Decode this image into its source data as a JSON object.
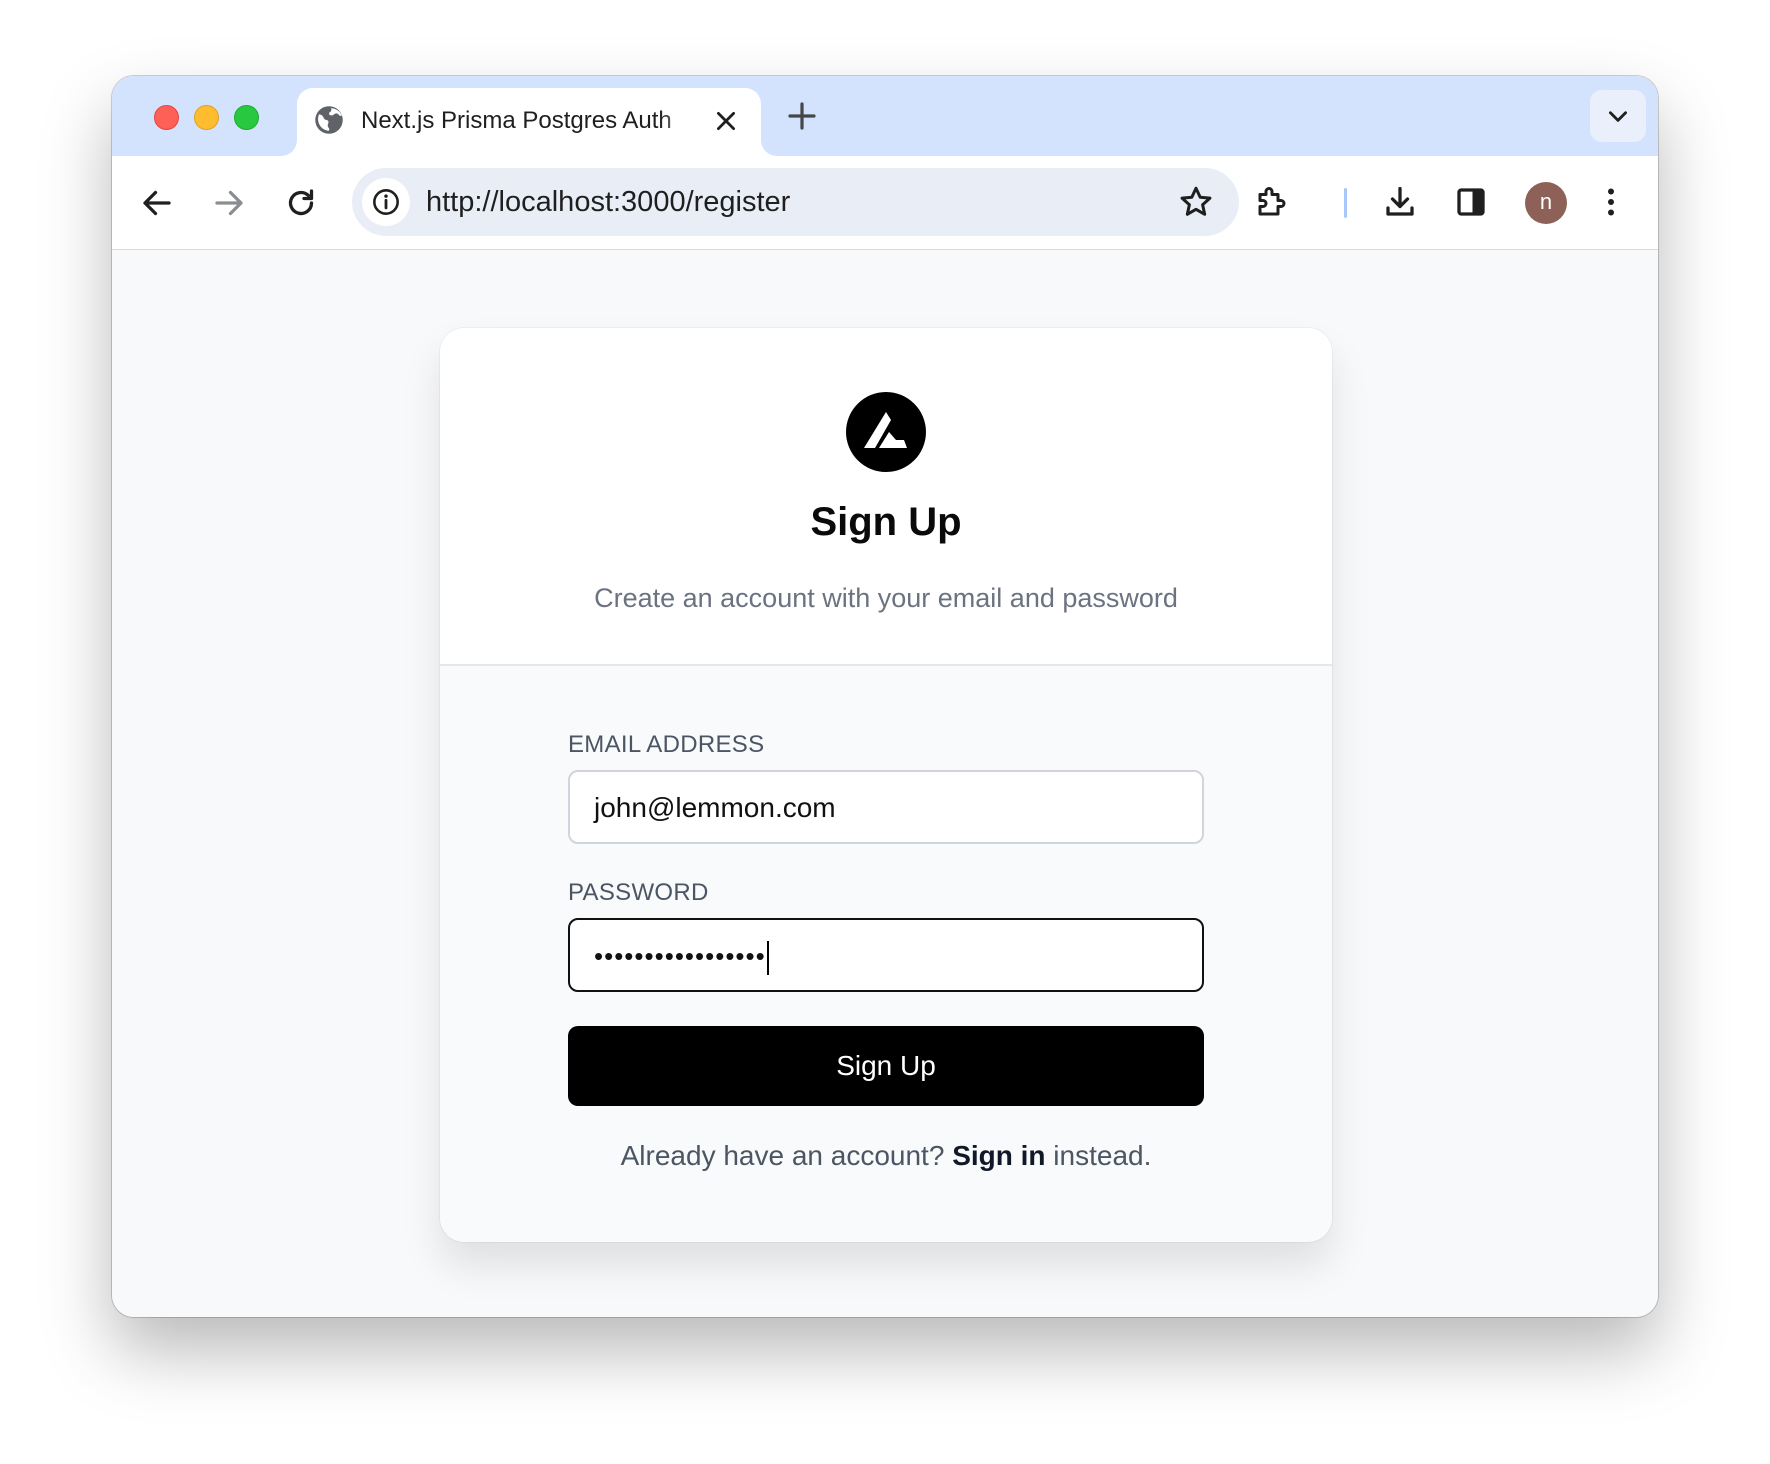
{
  "browser": {
    "tab_title": "Next.js Prisma Postgres Auth",
    "url": "http://localhost:3000/register",
    "profile_initial": "n"
  },
  "page": {
    "heading": "Sign Up",
    "subheading": "Create an account with your email and password",
    "email_label": "EMAIL ADDRESS",
    "email_value": "john@lemmon.com",
    "password_label": "PASSWORD",
    "password_value": "•••••••••••••••••",
    "submit_label": "Sign Up",
    "footer_prefix": "Already have an account? ",
    "footer_link": "Sign in",
    "footer_suffix": " instead."
  },
  "icons": {
    "tab": [
      "globe-icon",
      "close-icon",
      "plus-icon",
      "chevron-down-icon"
    ],
    "toolbar": [
      "arrow-left-icon",
      "arrow-right-icon",
      "reload-icon",
      "info-icon",
      "star-icon",
      "puzzle-icon",
      "download-icon",
      "side-panel-icon",
      "kebab-menu-icon"
    ],
    "page": [
      "logo-icon"
    ]
  },
  "colors": {
    "tabstrip": "#d3e3fd",
    "omnibox": "#e9eef6",
    "button": "#000000",
    "avatar": "#8d6158",
    "traffic_red": "#fe5f57",
    "traffic_yellow": "#febc2e",
    "traffic_green": "#28c840"
  }
}
